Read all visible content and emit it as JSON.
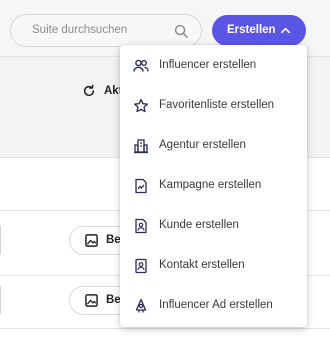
{
  "header": {
    "search": {
      "placeholder": "Suite durchsuchen",
      "icon": "search-icon"
    },
    "create_button": {
      "label": "Erstellen",
      "icon": "chevron-up-icon",
      "color": "#5b55e6"
    }
  },
  "toolbar": {
    "refresh_label": "Akt",
    "refresh_icon": "refresh-icon"
  },
  "rows": [
    {
      "button_label": "Be",
      "icon": "image-icon"
    },
    {
      "button_label": "Be",
      "icon": "image-icon"
    }
  ],
  "create_menu": {
    "items": [
      {
        "label": "Influencer erstellen",
        "icon": "users-icon"
      },
      {
        "label": "Favoritenliste erstellen",
        "icon": "star-icon"
      },
      {
        "label": "Agentur erstellen",
        "icon": "building-icon"
      },
      {
        "label": "Kampagne erstellen",
        "icon": "campaign-file-icon"
      },
      {
        "label": "Kunde erstellen",
        "icon": "client-file-icon"
      },
      {
        "label": "Kontakt erstellen",
        "icon": "contact-card-icon"
      },
      {
        "label": "Influencer Ad erstellen",
        "icon": "ad-megaphone-icon"
      }
    ]
  }
}
